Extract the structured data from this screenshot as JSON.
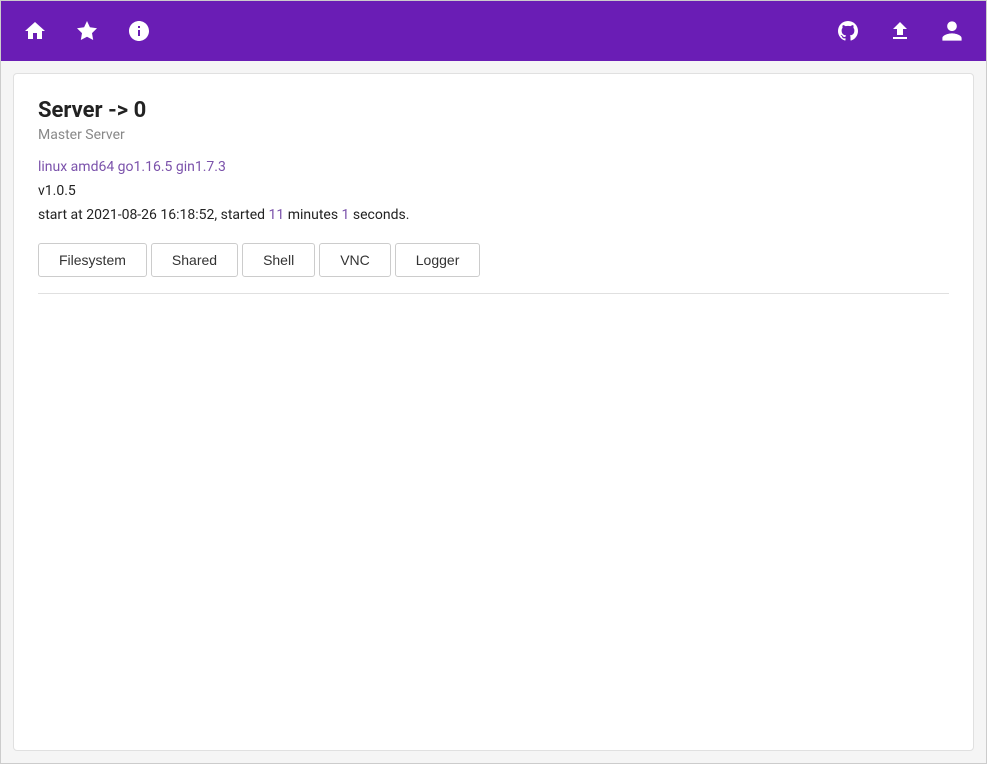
{
  "navbar": {
    "left_icons": [
      {
        "name": "home-icon",
        "symbol": "home"
      },
      {
        "name": "star-icon",
        "symbol": "star"
      },
      {
        "name": "info-icon",
        "symbol": "info"
      }
    ],
    "right_icons": [
      {
        "name": "github-icon",
        "symbol": "github"
      },
      {
        "name": "upload-icon",
        "symbol": "upload"
      },
      {
        "name": "account-icon",
        "symbol": "account"
      }
    ]
  },
  "server": {
    "title": "Server -> 0",
    "subtitle": "Master Server",
    "info_line": "linux amd64 go1.16.5 gin1.7.3",
    "version": "v1.0.5",
    "start_prefix": "start at 2021-08-26 16:18:52, started ",
    "started_minutes": "11",
    "minutes_label": " minutes ",
    "started_seconds": "1",
    "seconds_label": " seconds."
  },
  "tabs": [
    {
      "label": "Filesystem",
      "name": "tab-filesystem"
    },
    {
      "label": "Shared",
      "name": "tab-shared"
    },
    {
      "label": "Shell",
      "name": "tab-shell"
    },
    {
      "label": "VNC",
      "name": "tab-vnc"
    },
    {
      "label": "Logger",
      "name": "tab-logger"
    }
  ]
}
